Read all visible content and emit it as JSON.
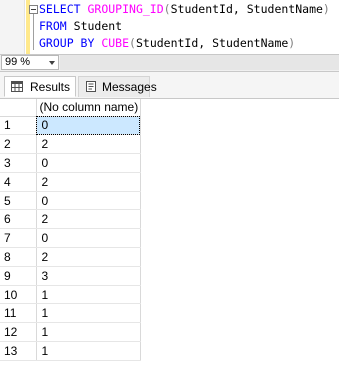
{
  "editor": {
    "line1": {
      "kw": "SELECT",
      "fn": "GROUPING_ID",
      "open": "(",
      "args": "StudentId, StudentName",
      "close": ")"
    },
    "line2": {
      "kw": "FROM",
      "table": "Student"
    },
    "line3": {
      "kw": "GROUP BY",
      "fn": "CUBE",
      "open": "(",
      "args": "StudentId, StudentName",
      "close": ")"
    }
  },
  "zoom": {
    "value": "99 %"
  },
  "tabs": [
    {
      "label": "Results",
      "icon": "grid-icon",
      "active": true
    },
    {
      "label": "Messages",
      "icon": "messages-icon",
      "active": false
    }
  ],
  "grid": {
    "column_header": "(No column name)",
    "rows": [
      {
        "num": "1",
        "value": "0"
      },
      {
        "num": "2",
        "value": "2"
      },
      {
        "num": "3",
        "value": "0"
      },
      {
        "num": "4",
        "value": "2"
      },
      {
        "num": "5",
        "value": "0"
      },
      {
        "num": "6",
        "value": "2"
      },
      {
        "num": "7",
        "value": "0"
      },
      {
        "num": "8",
        "value": "2"
      },
      {
        "num": "9",
        "value": "3"
      },
      {
        "num": "10",
        "value": "1"
      },
      {
        "num": "11",
        "value": "1"
      },
      {
        "num": "12",
        "value": "1"
      },
      {
        "num": "13",
        "value": "1"
      }
    ],
    "selected_row": "1"
  },
  "colors": {
    "keyword": "#0000ff",
    "function": "#ff00ff",
    "punctuation": "#808080",
    "selection": "#cce8ff"
  }
}
